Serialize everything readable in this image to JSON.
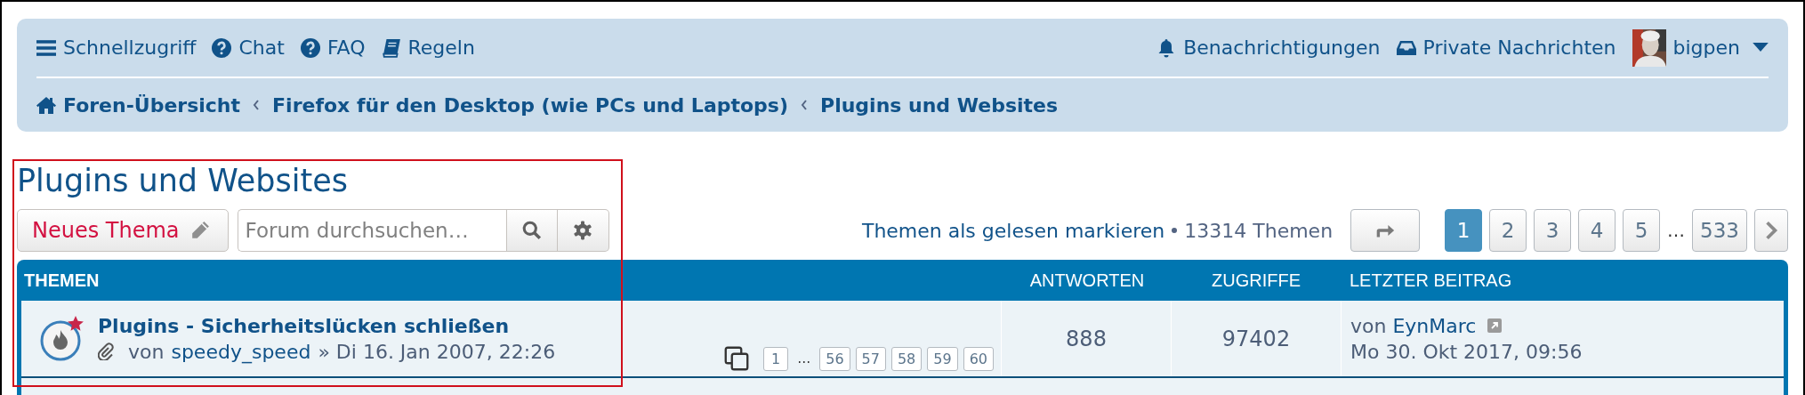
{
  "nav": {
    "items": [
      {
        "label": "Schnellzugriff"
      },
      {
        "label": "Chat"
      },
      {
        "label": "FAQ"
      },
      {
        "label": "Regeln"
      }
    ],
    "right_items": [
      {
        "label": "Benachrichtigungen"
      },
      {
        "label": "Private Nachrichten"
      }
    ],
    "user": {
      "name": "bigpen"
    }
  },
  "breadcrumbs": [
    {
      "label": "Foren-Übersicht"
    },
    {
      "label": "Firefox für den Desktop (wie PCs und Laptops)"
    },
    {
      "label": "Plugins und Websites"
    }
  ],
  "forum_title": "Plugins und Websites",
  "new_topic_button": "Neues Thema",
  "search": {
    "placeholder": "Forum durchsuchen…"
  },
  "mark_read": "Themen als gelesen markieren",
  "topic_count": "13314 Themen",
  "pagination": [
    {
      "kind": "page",
      "label": "1",
      "selected": true
    },
    {
      "kind": "page",
      "label": "2",
      "selected": false
    },
    {
      "kind": "page",
      "label": "3",
      "selected": false
    },
    {
      "kind": "page",
      "label": "4",
      "selected": false
    },
    {
      "kind": "page",
      "label": "5",
      "selected": false
    },
    {
      "kind": "gap",
      "label": "…"
    },
    {
      "kind": "page",
      "label": "533",
      "selected": false
    }
  ],
  "table": {
    "columns": [
      "THEMEN",
      "ANTWORTEN",
      "ZUGRIFFE",
      "LETZTER BEITRAG"
    ],
    "rows": [
      {
        "title": "Plugins - Sicherheitslücken schließen",
        "by": "von",
        "author": "speedy_speed",
        "date": "» Di 16. Jan 2007, 22:26",
        "pages": [
          {
            "kind": "page",
            "label": "1"
          },
          {
            "kind": "gap",
            "label": "…"
          },
          {
            "kind": "page",
            "label": "56"
          },
          {
            "kind": "page",
            "label": "57"
          },
          {
            "kind": "page",
            "label": "58"
          },
          {
            "kind": "page",
            "label": "59"
          },
          {
            "kind": "page",
            "label": "60"
          }
        ],
        "replies": "888",
        "views": "97402",
        "last_post": {
          "by": "von",
          "author": "EynMarc",
          "date": "Mo 30. Okt 2017, 09:56"
        }
      }
    ]
  }
}
